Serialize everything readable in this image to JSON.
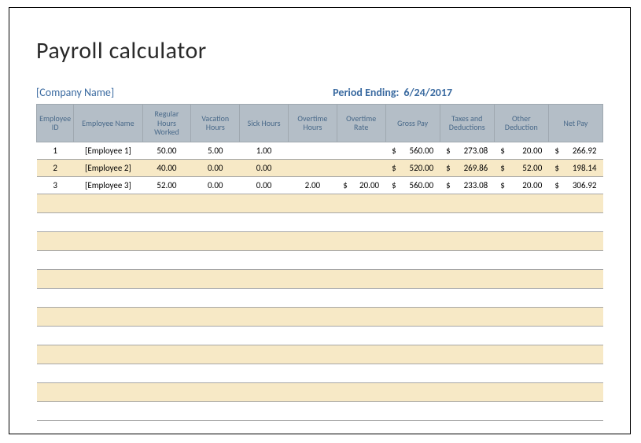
{
  "title": "Payroll calculator",
  "company": "[Company Name]",
  "period_label": "Period Ending:",
  "period_date": "6/24/2017",
  "columns": {
    "employee_id": "Employee ID",
    "employee_name": "Employee Name",
    "regular_hours": "Regular Hours Worked",
    "vacation_hours": "Vacation Hours",
    "sick_hours": "Sick Hours",
    "overtime_hours": "Overtime Hours",
    "overtime_rate": "Overtime Rate",
    "gross_pay": "Gross Pay",
    "taxes": "Taxes and Deductions",
    "other_deduction": "Other Deduction",
    "net_pay": "Net Pay"
  },
  "currency_symbol": "$",
  "rows": [
    {
      "id": "1",
      "name": "[Employee 1]",
      "regular_hours": "50.00",
      "vacation_hours": "5.00",
      "sick_hours": "1.00",
      "overtime_hours": "",
      "overtime_rate": "",
      "gross_pay": "560.00",
      "taxes": "273.08",
      "other_deduction": "20.00",
      "net_pay": "266.92"
    },
    {
      "id": "2",
      "name": "[Employee 2]",
      "regular_hours": "40.00",
      "vacation_hours": "0.00",
      "sick_hours": "0.00",
      "overtime_hours": "",
      "overtime_rate": "",
      "gross_pay": "520.00",
      "taxes": "269.86",
      "other_deduction": "52.00",
      "net_pay": "198.14"
    },
    {
      "id": "3",
      "name": "[Employee 3]",
      "regular_hours": "52.00",
      "vacation_hours": "0.00",
      "sick_hours": "0.00",
      "overtime_hours": "2.00",
      "overtime_rate": "20.00",
      "gross_pay": "560.00",
      "taxes": "233.08",
      "other_deduction": "20.00",
      "net_pay": "306.92"
    }
  ],
  "empty_row_count": 12,
  "chart_data": {
    "type": "table",
    "title": "Payroll calculator",
    "columns": [
      "Employee ID",
      "Employee Name",
      "Regular Hours Worked",
      "Vacation Hours",
      "Sick Hours",
      "Overtime Hours",
      "Overtime Rate",
      "Gross Pay",
      "Taxes and Deductions",
      "Other Deduction",
      "Net Pay"
    ],
    "rows": [
      [
        "1",
        "[Employee 1]",
        50.0,
        5.0,
        1.0,
        null,
        null,
        560.0,
        273.08,
        20.0,
        266.92
      ],
      [
        "2",
        "[Employee 2]",
        40.0,
        0.0,
        0.0,
        null,
        null,
        520.0,
        269.86,
        52.0,
        198.14
      ],
      [
        "3",
        "[Employee 3]",
        52.0,
        0.0,
        0.0,
        2.0,
        20.0,
        560.0,
        233.08,
        20.0,
        306.92
      ]
    ]
  }
}
